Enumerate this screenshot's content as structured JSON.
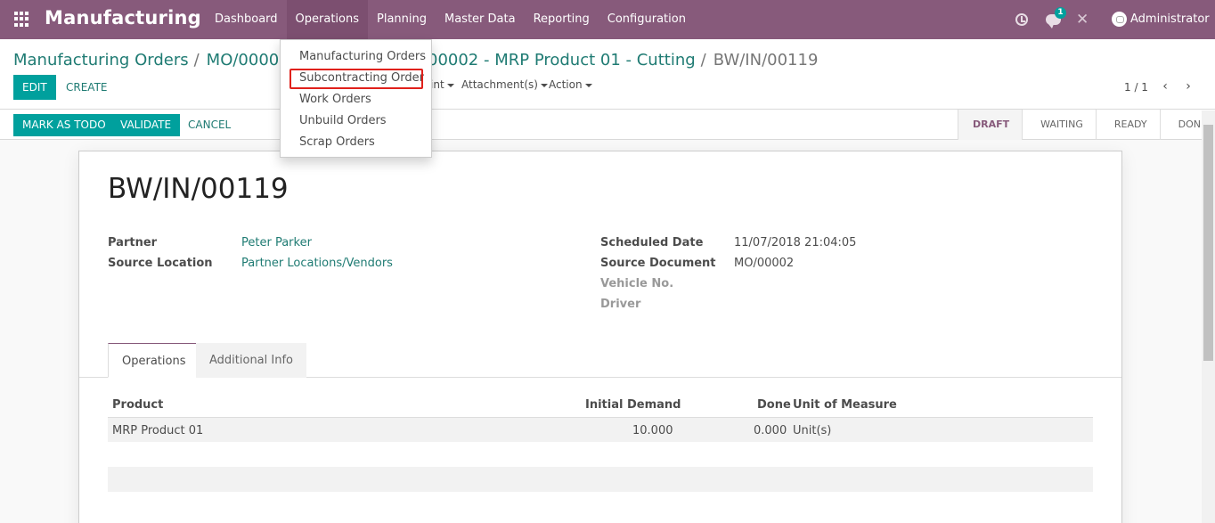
{
  "navbar": {
    "app_title": "Manufacturing",
    "menu": [
      "Dashboard",
      "Operations",
      "Planning",
      "Master Data",
      "Reporting",
      "Configuration"
    ],
    "active_menu": "Operations",
    "notification_count": "1",
    "user": "Administrator",
    "icons": [
      "apps-grid-icon",
      "clock-icon",
      "chat-icon",
      "tools-icon",
      "avatar"
    ]
  },
  "breadcrumb": {
    "items": [
      "Manufacturing Orders",
      "MO/00002",
      "00002 - MRP Product 01 - Cutting"
    ],
    "current": "BW/IN/00119",
    "separator": "/"
  },
  "buttons": {
    "edit": "EDIT",
    "create": "CREATE"
  },
  "actions": {
    "print": "int",
    "attachments": "Attachment(s)",
    "action": "Action"
  },
  "pager": {
    "value": "1 / 1"
  },
  "statusbar": {
    "mark_todo": "MARK AS TODO",
    "validate": "VALIDATE",
    "cancel": "CANCEL",
    "stages": [
      "DRAFT",
      "WAITING",
      "READY",
      "DONE"
    ],
    "active_stage": "DRAFT"
  },
  "form": {
    "title": "BW/IN/00119",
    "partner_label": "Partner",
    "partner_value": "Peter Parker",
    "source_location_label": "Source Location",
    "source_location_value": "Partner Locations/Vendors",
    "scheduled_date_label": "Scheduled Date",
    "scheduled_date_value": "11/07/2018 21:04:05",
    "source_document_label": "Source Document",
    "source_document_value": "MO/00002",
    "vehicle_label": "Vehicle No.",
    "driver_label": "Driver"
  },
  "tabs": [
    "Operations",
    "Additional Info"
  ],
  "table": {
    "headers": [
      "Product",
      "Initial Demand",
      "Done",
      "Unit of Measure"
    ],
    "rows": [
      [
        "MRP Product 01",
        "10.000",
        "0.000",
        "Unit(s)"
      ]
    ]
  },
  "dropdown": {
    "items": [
      "Manufacturing Orders",
      "Subcontracting Order",
      "Work Orders",
      "Unbuild Orders",
      "Scrap Orders"
    ],
    "highlighted": "Subcontracting Order"
  },
  "colors": {
    "navbar": "#875a7b",
    "primary": "#00a09d",
    "link": "#1f7b73",
    "highlight": "#e0211b"
  }
}
